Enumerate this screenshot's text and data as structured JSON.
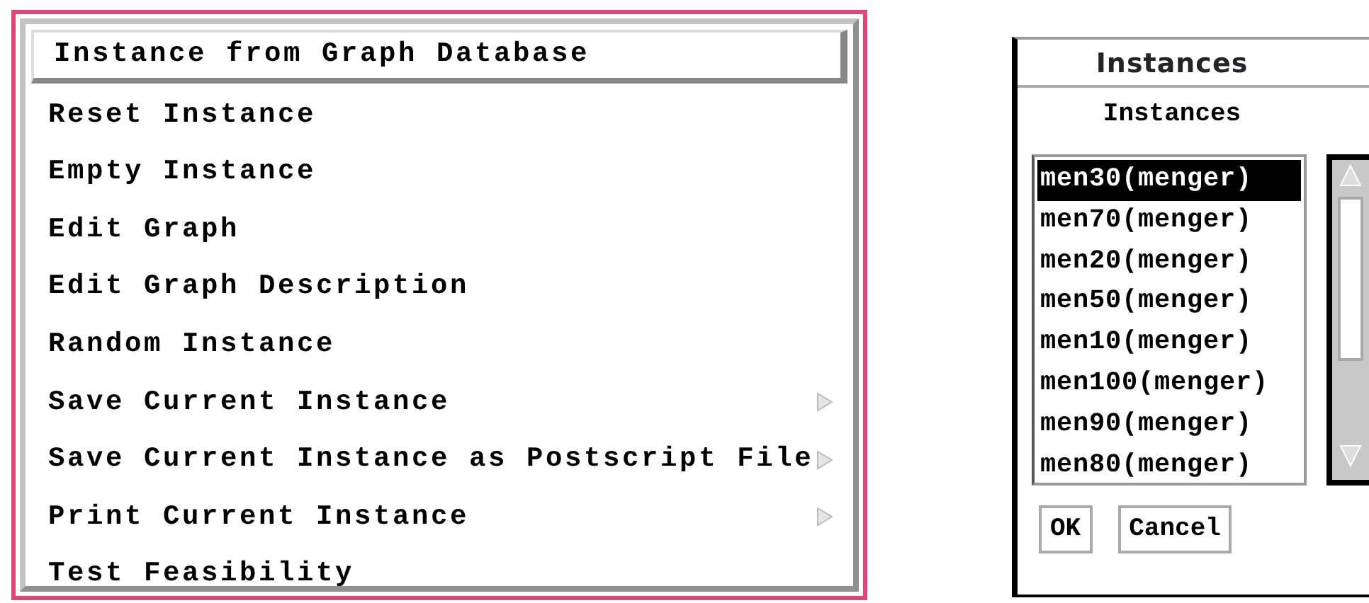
{
  "menu": {
    "items": [
      {
        "label": "Instance from Graph Database",
        "selected": true,
        "submenu": false
      },
      {
        "label": "Reset Instance",
        "selected": false,
        "submenu": false
      },
      {
        "label": "Empty Instance",
        "selected": false,
        "submenu": false
      },
      {
        "label": "Edit Graph",
        "selected": false,
        "submenu": false
      },
      {
        "label": "Edit Graph Description",
        "selected": false,
        "submenu": false
      },
      {
        "label": "Random Instance",
        "selected": false,
        "submenu": false
      },
      {
        "label": "Save Current Instance",
        "selected": false,
        "submenu": true
      },
      {
        "label": "Save Current Instance as Postscript File",
        "selected": false,
        "submenu": true
      },
      {
        "label": "Print Current Instance",
        "selected": false,
        "submenu": true
      },
      {
        "label": "Test Feasibility",
        "selected": false,
        "submenu": false
      }
    ]
  },
  "dialog": {
    "title": "Instances",
    "label": "Instances",
    "list": [
      {
        "label": "men30(menger)",
        "selected": true
      },
      {
        "label": "men70(menger)",
        "selected": false
      },
      {
        "label": "men20(menger)",
        "selected": false
      },
      {
        "label": "men50(menger)",
        "selected": false
      },
      {
        "label": "men10(menger)",
        "selected": false
      },
      {
        "label": "men100(menger)",
        "selected": false
      },
      {
        "label": "men90(menger)",
        "selected": false
      },
      {
        "label": "men80(menger)",
        "selected": false
      }
    ],
    "buttons": [
      "OK",
      "Cancel"
    ]
  }
}
